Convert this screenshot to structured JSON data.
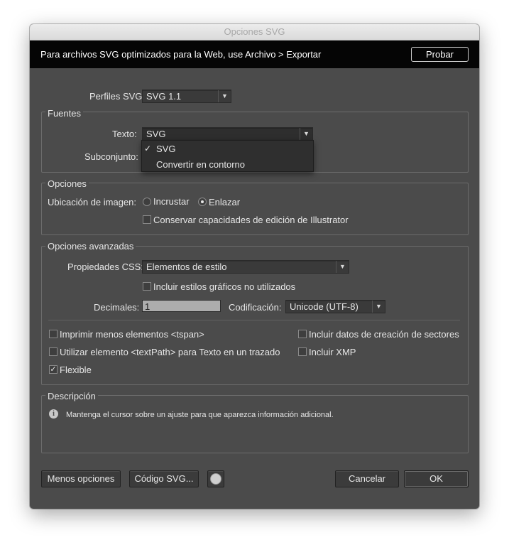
{
  "window": {
    "title": "Opciones SVG"
  },
  "banner": {
    "text": "Para archivos SVG optimizados para la Web, use Archivo > Exportar",
    "button": "Probar"
  },
  "profiles": {
    "label": "Perfiles SVG",
    "value": "SVG 1.1"
  },
  "fonts": {
    "title": "Fuentes",
    "text_label": "Texto:",
    "text_value": "SVG",
    "subset_label": "Subconjunto:",
    "menu": {
      "items": [
        {
          "label": "SVG",
          "checked": true
        },
        {
          "label": "Convertir en contorno",
          "checked": false
        }
      ]
    }
  },
  "options": {
    "title": "Opciones",
    "image_location_label": "Ubicación de imagen:",
    "embed_label": "Incrustar",
    "link_label": "Enlazar",
    "selected": "Enlazar",
    "preserve_label": "Conservar capacidades de edición de Illustrator"
  },
  "advanced": {
    "title": "Opciones avanzadas",
    "css_label": "Propiedades CSS:",
    "css_value": "Elementos de estilo",
    "include_unused_label": "Incluir estilos gráficos no utilizados",
    "decimals_label": "Decimales:",
    "decimals_value": "1",
    "encoding_label": "Codificación:",
    "encoding_value": "Unicode (UTF-8)",
    "tspan_label": "Imprimir menos elementos <tspan>",
    "textpath_label": "Utilizar elemento <textPath> para Texto en un trazado",
    "responsive_label": "Flexible",
    "responsive_checked": true,
    "slices_label": "Incluir datos de creación de sectores",
    "xmp_label": "Incluir XMP"
  },
  "description": {
    "title": "Descripción",
    "text": "Mantenga el cursor sobre un ajuste para que aparezca información adicional."
  },
  "buttons": {
    "less_options": "Menos opciones",
    "svg_code": "Código SVG...",
    "cancel": "Cancelar",
    "ok": "OK"
  },
  "icons": {
    "info": "info-icon",
    "globe": "globe-icon",
    "check": "checkmark-icon",
    "dropdown": "chevron-down-icon"
  }
}
